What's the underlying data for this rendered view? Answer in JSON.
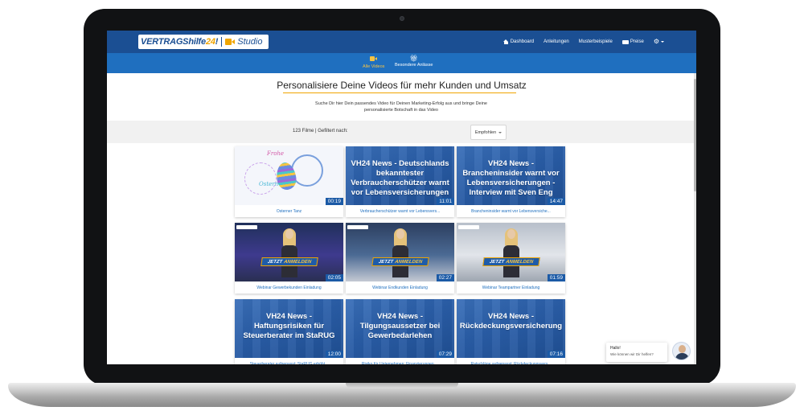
{
  "header": {
    "logo_brand": "VERTRAGShilfe",
    "logo_num": "24",
    "logo_excl": "!",
    "logo_product": "Studio",
    "nav": [
      {
        "label": "Dashboard",
        "icon": "home-icon"
      },
      {
        "label": "Anleitungen",
        "icon": ""
      },
      {
        "label": "Musterbeispiele",
        "icon": ""
      },
      {
        "label": "Preise",
        "icon": "tag-icon"
      }
    ],
    "settings_icon": "gear-icon"
  },
  "subnav": {
    "tabs": [
      {
        "label": "Alle Videos",
        "icon": "video-camera-icon",
        "active": true
      },
      {
        "label": "Besondere Anlässe",
        "icon": "gift-icon",
        "active": false
      }
    ]
  },
  "hero": {
    "title": "Personalisiere Deine Videos für mehr Kunden und Umsatz",
    "subtitle_line1": "Suche Dir hier Dein passendes Video für Deinen Marketing-Erfolg aus und bringe Deine",
    "subtitle_line2": "personalisierte Botschaft in das Video"
  },
  "filter": {
    "count_text": "123 Filme | Gefiltert nach:",
    "sort_value": "Empfohlen"
  },
  "videos": [
    {
      "kind": "easter",
      "headline": "",
      "duration": "00:19",
      "caption": "Osterner Tanz"
    },
    {
      "kind": "news",
      "headline": "VH24 News - Deutschlands bekanntester Verbraucherschützer warnt vor Lebensversicherungen",
      "duration": "11:01",
      "caption": "Verbraucherschützer warnt vor Lebensvers..."
    },
    {
      "kind": "news",
      "headline": "VH24 News - Brancheninsider warnt vor Lebensversicherungen - Interview mit Sven Eng",
      "duration": "14:47",
      "caption": "Brancheninsider warnt vor Lebensversiche..."
    },
    {
      "kind": "webinar",
      "headline": "",
      "duration": "02:05",
      "caption": "Webinar Gewerbekunden Einladung"
    },
    {
      "kind": "webinar",
      "headline": "",
      "duration": "02:27",
      "caption": "Webinar Endkunden Einladung"
    },
    {
      "kind": "webinar",
      "headline": "",
      "duration": "01:59",
      "caption": "Webinar Teampartner Einladung"
    },
    {
      "kind": "news",
      "headline": "VH24 News - Haftungsrisiken für Steuerberater im StaRUG",
      "duration": "12:00",
      "caption": "Steuerberater aufgepasst: StaRUG erhöht..."
    },
    {
      "kind": "news",
      "headline": "VH24 News - Tilgungsaussetzer bei Gewerbedarlehen",
      "duration": "07:29",
      "caption": "Risiko für Unternehmen: Finanzierungen ..."
    },
    {
      "kind": "news",
      "headline": "VH24 News - Rückdeckungsversicherung",
      "duration": "07:16",
      "caption": "Ratschläge aufgepasst: Rückdeckungsvers..."
    }
  ],
  "webinar_cta": {
    "word1": "JETZT",
    "word2": "ANMELDEN"
  },
  "easter_art": {
    "script1": "Frohe",
    "script2": "Ostern"
  },
  "chat": {
    "greeting": "Hallo!",
    "question": "Wie können wir Dir helfen?"
  },
  "colors": {
    "primary": "#1b4f93",
    "secondary": "#1f6fbf",
    "accent": "#f0a500"
  }
}
